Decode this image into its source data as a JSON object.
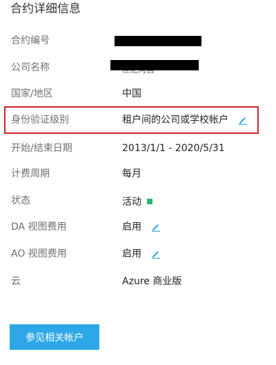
{
  "title": "合约详细信息",
  "fields": {
    "contract_number": {
      "label": "合约编号"
    },
    "company_name": {
      "label": "公司名称",
      "value_fragment": "世纪沟自"
    },
    "country": {
      "label": "国家/地区",
      "value": "中国"
    },
    "auth_level": {
      "label": "身份验证级别",
      "value": "租户间的公司或学校帐户"
    },
    "date_range": {
      "label": "开始/结束日期",
      "value": "2013/1/1 - 2020/5/31"
    },
    "billing_cycle": {
      "label": "计费周期",
      "value": "每月"
    },
    "status": {
      "label": "状态",
      "value": "活动"
    },
    "da_view_fee": {
      "label": "DA 视图费用",
      "value": "启用"
    },
    "ao_view_fee": {
      "label": "AO 视图费用",
      "value": "启用"
    },
    "cloud": {
      "label": "云",
      "value": "Azure 商业版"
    }
  },
  "button": {
    "label": "参见相关帐户"
  },
  "colors": {
    "highlight_border": "#d0212d",
    "status_active": "#2bb673",
    "button_bg": "#2ea7e8",
    "edit_icon": "#2ea7e8"
  },
  "icons": {
    "edit": "pencil-icon",
    "status": "status-square-icon"
  }
}
